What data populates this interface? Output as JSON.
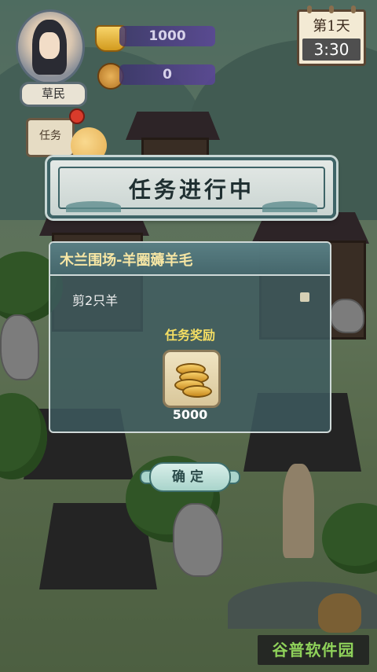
{
  "hud": {
    "rank": "草民",
    "gold_amount": "1000",
    "copper_amount": "0",
    "day_label": "第1天",
    "time": "3:30",
    "task_tab": "任务"
  },
  "dialog": {
    "title": "任务进行中",
    "task_name": "木兰围场-羊圈薅羊毛",
    "task_requirement": "剪2只羊",
    "reward_heading": "任务奖励",
    "reward_amount": "5000",
    "reward_icon": "gold-coins-icon",
    "confirm_label": "确定"
  },
  "watermark": "谷普软件园",
  "colors": {
    "panel_bg": "#3e5c60",
    "task_title": "#f6e6a4",
    "reward_heading": "#f5de63"
  }
}
